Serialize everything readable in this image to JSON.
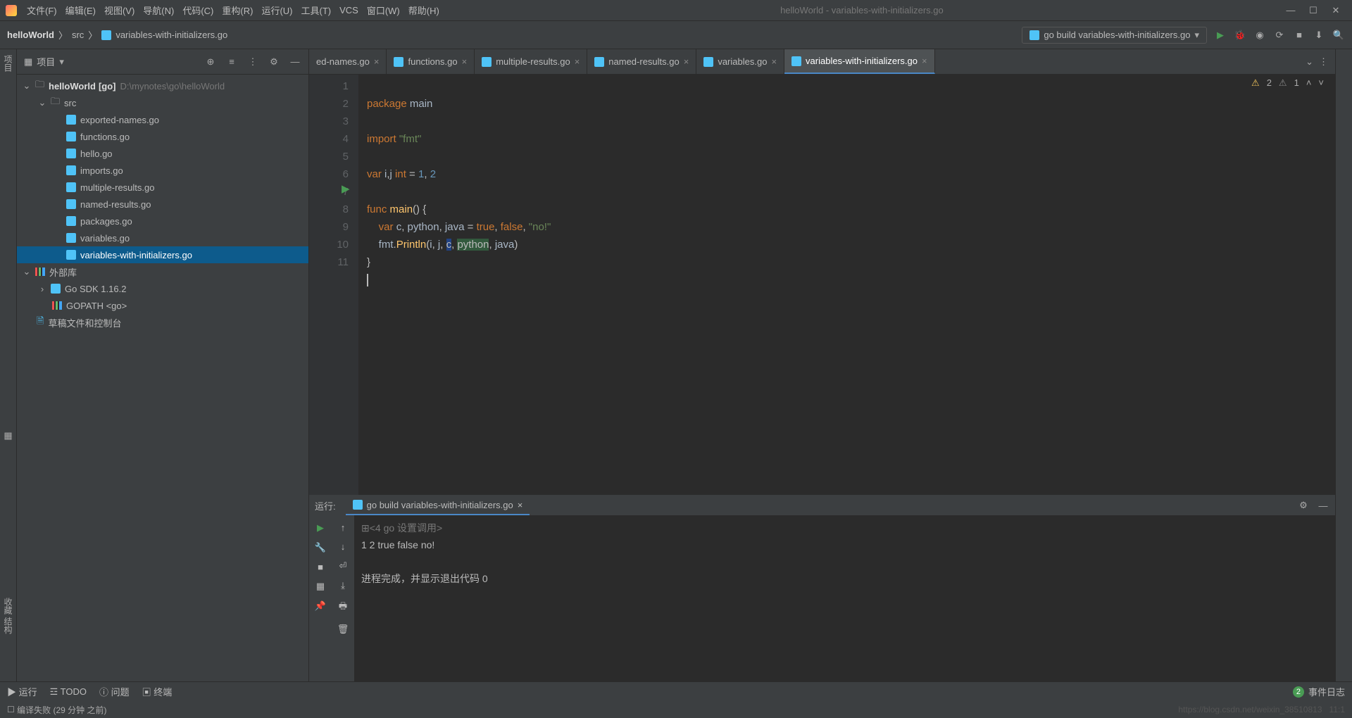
{
  "title": "helloWorld - variables-with-initializers.go",
  "menu": [
    "文件(F)",
    "编辑(E)",
    "视图(V)",
    "导航(N)",
    "代码(C)",
    "重构(R)",
    "运行(U)",
    "工具(T)",
    "VCS",
    "窗口(W)",
    "帮助(H)"
  ],
  "breadcrumb": {
    "project": "helloWorld",
    "folder": "src",
    "file": "variables-with-initializers.go"
  },
  "run_config": "go build variables-with-initializers.go",
  "sidebar": {
    "title": "项目",
    "project": {
      "name": "helloWorld",
      "tag": "[go]",
      "path": "D:\\mynotes\\go\\helloWorld"
    },
    "src_label": "src",
    "files": [
      "exported-names.go",
      "functions.go",
      "hello.go",
      "imports.go",
      "multiple-results.go",
      "named-results.go",
      "packages.go",
      "variables.go",
      "variables-with-initializers.go"
    ],
    "ext_lib": "外部库",
    "go_sdk": "Go SDK 1.16.2",
    "gopath": "GOPATH <go>",
    "scratch": "草稿文件和控制台"
  },
  "tabs": [
    "ed-names.go",
    "functions.go",
    "multiple-results.go",
    "named-results.go",
    "variables.go",
    "variables-with-initializers.go"
  ],
  "active_tab": 5,
  "warnings": {
    "yellow": "2",
    "gray": "1"
  },
  "code_lines": [
    "1",
    "2",
    "3",
    "4",
    "5",
    "6",
    "7",
    "8",
    "9",
    "10",
    "11"
  ],
  "run_panel": {
    "label": "运行:",
    "tab": "go build variables-with-initializers.go",
    "header": "<4 go 设置调用>",
    "output": "1 2 true false no!",
    "exit": "进程完成，并显示退出代码 0"
  },
  "bottom_tabs": {
    "run": "运行",
    "todo": "TODO",
    "problems": "问题",
    "terminal": "终端"
  },
  "event_log": {
    "count": "2",
    "label": "事件日志"
  },
  "status": "编译失败 (29 分钟 之前)",
  "watermark": "https://blog.csdn.net/weixin_38510813",
  "line_col": "11:1"
}
